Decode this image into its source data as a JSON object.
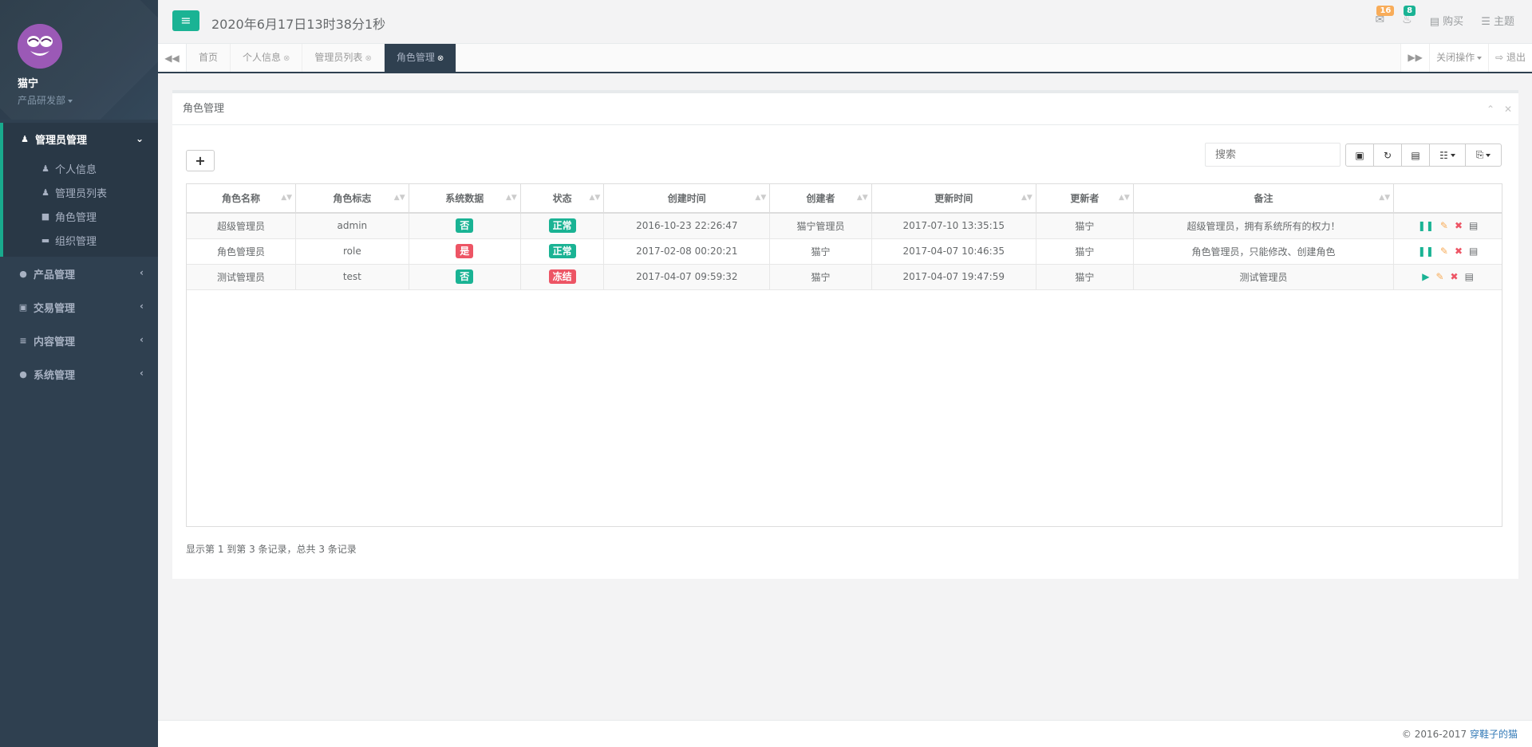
{
  "user": {
    "name": "猫宁",
    "dept": "产品研发部"
  },
  "menu": {
    "active_group": {
      "label": "管理员管理",
      "arrow": "⌄",
      "items": [
        {
          "label": "个人信息",
          "icon": "user-md-icon"
        },
        {
          "label": "管理员列表",
          "icon": "users-icon"
        },
        {
          "label": "角色管理",
          "icon": "lock-icon"
        },
        {
          "label": "组织管理",
          "icon": "sitemap-icon"
        }
      ]
    },
    "groups": [
      {
        "label": "产品管理",
        "icon": "product-icon"
      },
      {
        "label": "交易管理",
        "icon": "money-icon"
      },
      {
        "label": "内容管理",
        "icon": "list-icon"
      },
      {
        "label": "系统管理",
        "icon": "gear-icon"
      }
    ],
    "collapsed_arrow": "‹"
  },
  "topbar": {
    "datetime": "2020年6月17日13时38分1秒",
    "mail_badge": "16",
    "bell_badge": "8",
    "buy": "购买",
    "theme": "主题"
  },
  "tabs": {
    "items": [
      "首页",
      "个人信息",
      "管理员列表",
      "角色管理"
    ],
    "close_ops": "关闭操作",
    "logout": "退出"
  },
  "panel": {
    "title": "角色管理",
    "search_placeholder": "搜索"
  },
  "table": {
    "columns": [
      "角色名称",
      "角色标志",
      "系统数据",
      "状态",
      "创建时间",
      "创建者",
      "更新时间",
      "更新者",
      "备注"
    ],
    "rows": [
      {
        "name": "超级管理员",
        "flag": "admin",
        "system": "否",
        "status": "正常",
        "created": "2016-10-23 22:26:47",
        "creator": "猫宁管理员",
        "updated": "2017-07-10 13:35:15",
        "updater": "猫宁",
        "remark": "超级管理员，拥有系统所有的权力！",
        "action": "pause"
      },
      {
        "name": "角色管理员",
        "flag": "role",
        "system": "是",
        "status": "正常",
        "created": "2017-02-08 00:20:21",
        "creator": "猫宁",
        "updated": "2017-04-07 10:46:35",
        "updater": "猫宁",
        "remark": "角色管理员，只能修改、创建角色",
        "action": "pause"
      },
      {
        "name": "测试管理员",
        "flag": "test",
        "system": "否",
        "status": "冻结",
        "created": "2017-04-07 09:59:32",
        "creator": "猫宁",
        "updated": "2017-04-07 19:47:59",
        "updater": "猫宁",
        "remark": "测试管理员",
        "action": "play"
      }
    ]
  },
  "pagination": "显示第 1 到第 3 条记录，总共 3 条记录",
  "footer": {
    "copyright": "© 2016-2017",
    "author": "穿鞋子的猫"
  },
  "colors": {
    "primary": "#1ab394",
    "danger": "#ed5565",
    "warning": "#f8ac59",
    "sidebar": "#2f4050"
  }
}
